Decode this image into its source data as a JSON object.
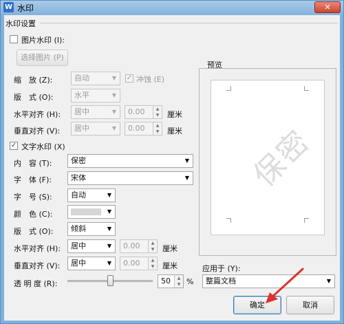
{
  "window": {
    "title": "水印",
    "app_icon": "wps-writer-icon",
    "close_label": "✕"
  },
  "section": {
    "title": "水印设置"
  },
  "picture": {
    "checkbox_label": "图片水印 (I):",
    "checked": false,
    "select_button": "选择图片 (P)",
    "scale_label": "缩　放 (Z):",
    "scale_value": "自动",
    "washout_label": "冲蚀 (E)",
    "washout_checked": true,
    "layout_label": "版　式 (O):",
    "layout_value": "水平",
    "halign_label": "水平对齐 (H):",
    "halign_value": "居中",
    "halign_offset": "0.00",
    "valign_label": "垂直对齐 (V):",
    "valign_value": "居中",
    "valign_offset": "0.00",
    "unit": "厘米"
  },
  "text": {
    "checkbox_label": "文字水印 (X)",
    "checked": true,
    "content_label": "内　容 (T):",
    "content_value": "保密",
    "font_label": "字　体 (F):",
    "font_value": "宋体",
    "size_label": "字　号 (S):",
    "size_value": "自动",
    "color_label": "颜　色 (C):",
    "color_value": "#d6d6d6",
    "layout_label": "版　式 (O):",
    "layout_value": "倾斜",
    "halign_label": "水平对齐 (H):",
    "halign_value": "居中",
    "halign_offset": "0.00",
    "valign_label": "垂直对齐 (V):",
    "valign_value": "居中",
    "valign_offset": "0.00",
    "unit": "厘米",
    "transparency_label": "透 明 度 (R):",
    "transparency_value": "50",
    "transparency_unit": "%"
  },
  "preview": {
    "label": "预览",
    "watermark_text": "保密"
  },
  "apply": {
    "label": "应用于 (Y):",
    "value": "整篇文档"
  },
  "footer": {
    "ok_label": "确定",
    "cancel_label": "取消"
  },
  "colors": {
    "titlebar": "#86b3dc",
    "dialog_bg": "#f0f0f0",
    "annotation_arrow": "#e0302a"
  }
}
